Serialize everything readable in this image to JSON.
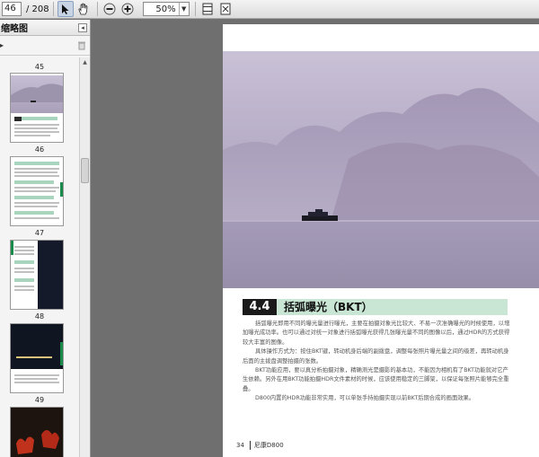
{
  "toolbar": {
    "current_page": "46",
    "page_total": "/ 208",
    "zoom": "50%",
    "icons": [
      "select-tool-icon",
      "hand-tool-icon",
      "zoom-out-icon",
      "zoom-in-icon",
      "fit-page-icon",
      "fit-width-icon"
    ]
  },
  "sidebar": {
    "title": "缩略图",
    "thumbnails": [
      {
        "label": "45"
      },
      {
        "label": "46"
      },
      {
        "label": "47"
      },
      {
        "label": "48"
      },
      {
        "label": "49"
      }
    ]
  },
  "page": {
    "section_number": "4.4",
    "section_title": "括弧曝光（BKT）",
    "paragraphs": [
      "括弧曝光即用不同的曝光量进行曝光，主要在拍摄对象光比较大、不易一次准确曝光的时候使用，以增加曝光成功率。也可以通过对统一对象进行括弧曝光获得几张曝光量不同的图像以后，通过HDR的方式获得较大丰富的图像。",
      "具体操作方式为：按住BKT键，转动机身后端的副拨盘，调整每张照片曝光量之间的级差，再转动机身后面的主拨盘调整拍摄的张数。",
      "BKT功能应用，要以真分析拍摄对象，精确测光是摄影的基本功，不能因为相机有了BKT功能就对它产生依赖。另外在用BKT功能拍摄HDR文件素材的时候，应该使用稳定的三脚架，以保证每张照片能够完全重叠。",
      "D800内置的HDR功能非常实用，可以单张手持拍摄实现以前BKT后期合成的画面效果。"
    ],
    "page_number": "34",
    "footer_title": "尼康D800"
  },
  "colors": {
    "section_band": "#c9e6d4",
    "section_number_bg": "#1a1a1a",
    "viewer_bg": "#6f6f6f"
  }
}
